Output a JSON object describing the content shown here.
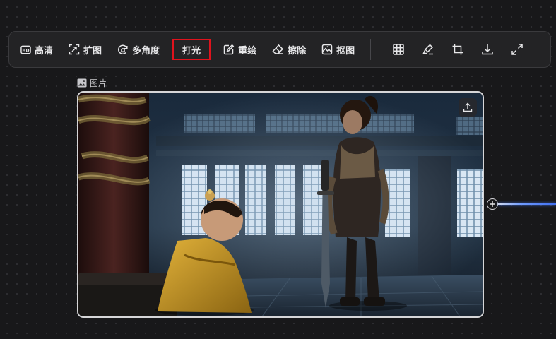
{
  "toolbar": {
    "tools": [
      {
        "label": "高清",
        "icon": "hd-icon"
      },
      {
        "label": "扩图",
        "icon": "expand-image-icon"
      },
      {
        "label": "多角度",
        "icon": "rotate-3d-icon"
      },
      {
        "label": "打光",
        "icon": "",
        "active": true
      },
      {
        "label": "重绘",
        "icon": "edit-icon"
      },
      {
        "label": "擦除",
        "icon": "eraser-icon"
      },
      {
        "label": "抠图",
        "icon": "cutout-icon"
      }
    ],
    "icon_buttons": [
      "grid-icon",
      "brush-icon",
      "crop-icon",
      "download-icon",
      "fullscreen-icon"
    ]
  },
  "node": {
    "label": "图片",
    "label_icon": "image-icon",
    "upload_icon": "upload-icon"
  },
  "colors": {
    "canvas_bg": "#18181a",
    "toolbar_bg": "#232325",
    "active_outline": "#e0131d",
    "connector": "#4b7dff"
  }
}
